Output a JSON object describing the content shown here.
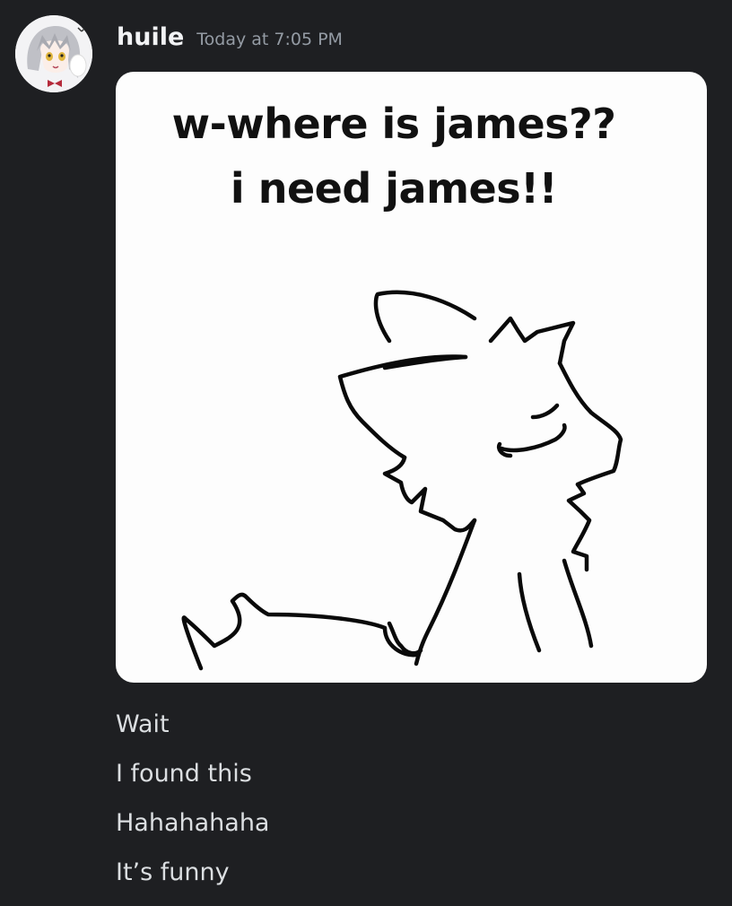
{
  "author": {
    "username": "huile",
    "timestamp": "Today at 7:05 PM",
    "avatar_icon": "anime-girl-avatar"
  },
  "attachment": {
    "caption_lines": [
      "w-where is james??",
      "i need james!!"
    ],
    "drawing_icon": "cat-sketch-drawing"
  },
  "message_lines": [
    "Wait",
    "I found this",
    "Hahahahaha",
    "It’s funny"
  ],
  "colors": {
    "background": "#1e1f22",
    "username": "#f2f3f5",
    "timestamp": "#949ba4",
    "text": "#dbdee1"
  }
}
